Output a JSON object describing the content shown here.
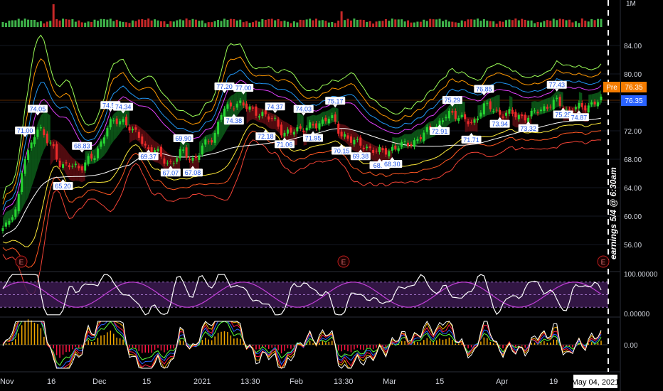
{
  "chart_data": [
    {
      "type": "candlestick",
      "x_ticks": [
        "Nov",
        "16",
        "Dec",
        "15",
        "2021",
        "13:30",
        "Feb",
        "13:30",
        "Mar",
        "15",
        "Apr",
        "19",
        "May 04, 2021"
      ],
      "price_axis": {
        "ylim": [
          52,
          88
        ],
        "ticks": [
          "84.00",
          "80.00",
          "76.00",
          "72.00",
          "68.00",
          "64.00",
          "60.00",
          "56.00"
        ]
      },
      "last_price": {
        "pre_label": "Pre",
        "pre_value": "76.35",
        "value": "76.35",
        "pre_color": "#f57c00",
        "color": "#2962ff"
      },
      "annotations": [
        {
          "text": "71.00",
          "i": 7,
          "pos": "above",
          "price": 71.0
        },
        {
          "text": "74.05",
          "i": 11,
          "pos": "above",
          "price": 74.05
        },
        {
          "text": "65.20",
          "i": 19,
          "pos": "below",
          "price": 65.2
        },
        {
          "text": "68.83",
          "i": 25,
          "pos": "above",
          "price": 68.83
        },
        {
          "text": "74.57",
          "i": 34,
          "pos": "above",
          "price": 74.57
        },
        {
          "text": "74.34",
          "i": 38,
          "pos": "above",
          "price": 74.34
        },
        {
          "text": "69.37",
          "i": 46,
          "pos": "below",
          "price": 69.37
        },
        {
          "text": "67.07",
          "i": 53,
          "pos": "below",
          "price": 67.07
        },
        {
          "text": "69.90",
          "i": 57,
          "pos": "above",
          "price": 69.9
        },
        {
          "text": "67.08",
          "i": 60,
          "pos": "below",
          "price": 67.08
        },
        {
          "text": "77.20",
          "i": 70,
          "pos": "above",
          "price": 77.2
        },
        {
          "text": "77.00",
          "i": 76,
          "pos": "above",
          "price": 77.0
        },
        {
          "text": "74.38",
          "i": 73,
          "pos": "below",
          "price": 74.38
        },
        {
          "text": "74.37",
          "i": 86,
          "pos": "above",
          "price": 74.37
        },
        {
          "text": "72.18",
          "i": 83,
          "pos": "below",
          "price": 72.18
        },
        {
          "text": "71.06",
          "i": 89,
          "pos": "below",
          "price": 71.06
        },
        {
          "text": "74.03",
          "i": 95,
          "pos": "above",
          "price": 74.03
        },
        {
          "text": "71.95",
          "i": 98,
          "pos": "below",
          "price": 71.95
        },
        {
          "text": "75.17",
          "i": 105,
          "pos": "above",
          "price": 75.17
        },
        {
          "text": "70.15",
          "i": 107,
          "pos": "below",
          "price": 70.15
        },
        {
          "text": "69.38",
          "i": 113,
          "pos": "below",
          "price": 69.38
        },
        {
          "text": "68.1",
          "i": 119,
          "pos": "below",
          "price": 68.1
        },
        {
          "text": "68.30",
          "i": 123,
          "pos": "below",
          "price": 68.3
        },
        {
          "text": "72.91",
          "i": 138,
          "pos": "below",
          "price": 72.91
        },
        {
          "text": "75.29",
          "i": 142,
          "pos": "above",
          "price": 75.29
        },
        {
          "text": "71.71",
          "i": 148,
          "pos": "below",
          "price": 71.71
        },
        {
          "text": "76.85",
          "i": 152,
          "pos": "above",
          "price": 76.85
        },
        {
          "text": "73.94",
          "i": 157,
          "pos": "below",
          "price": 73.94
        },
        {
          "text": "73.32",
          "i": 166,
          "pos": "below",
          "price": 73.32
        },
        {
          "text": "77.43",
          "i": 175,
          "pos": "above",
          "price": 77.43
        },
        {
          "text": "75.25",
          "i": 177,
          "pos": "below",
          "price": 75.25
        },
        {
          "text": "74.87",
          "i": 182,
          "pos": "below",
          "price": 74.87
        }
      ],
      "earnings_markers": [
        "E",
        "E",
        "E"
      ],
      "vertical_note": "earnings 5/4 @ 6:30am",
      "volume_label": "1M"
    },
    {
      "type": "line",
      "y_ticks": [
        "100.00000",
        "0.00000"
      ],
      "series_colors": [
        "#ffffff",
        "#c23fd8"
      ],
      "band_color": "#3b1a50"
    },
    {
      "type": "line",
      "y_ticks": [
        "0.00"
      ],
      "series_colors": [
        "#5bff3a",
        "#2962ff",
        "#ff1744",
        "#f2a900",
        "#ffffff"
      ]
    }
  ]
}
